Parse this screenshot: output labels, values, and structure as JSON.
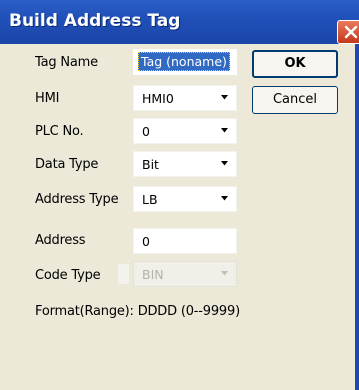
{
  "window": {
    "title": "Build Address Tag"
  },
  "form": {
    "tag_name": {
      "label": "Tag Name",
      "value": "Tag (noname)"
    },
    "hmi": {
      "label": "HMI",
      "value": "HMI0"
    },
    "plc_no": {
      "label": "PLC No.",
      "value": "0"
    },
    "data_type": {
      "label": "Data Type",
      "value": "Bit"
    },
    "address_type": {
      "label": "Address Type",
      "value": "LB"
    },
    "address": {
      "label": "Address",
      "value": "0"
    },
    "code_type": {
      "label": "Code Type",
      "value": "BIN",
      "disabled": true
    },
    "format": {
      "label": "Format(Range):",
      "value": "DDDD (0--9999)"
    }
  },
  "buttons": {
    "ok_label": "OK",
    "cancel_label": "Cancel"
  },
  "colors": {
    "titlebar": "#1f4fb7",
    "dialog_bg": "#ece9d8",
    "selection": "#316ac5",
    "close_button": "#c2391c"
  },
  "icons": [
    "close-icon",
    "chevron-down-icon"
  ]
}
